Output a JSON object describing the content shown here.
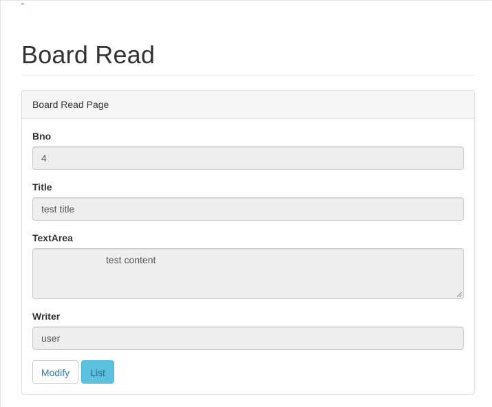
{
  "stray_mark": "\"",
  "page": {
    "title": "Board Read"
  },
  "panel": {
    "heading": "Board Read Page"
  },
  "fields": {
    "bno": {
      "label": "Bno",
      "value": "4"
    },
    "title": {
      "label": "Title",
      "value": "test title"
    },
    "textarea": {
      "label": "TextArea",
      "value": "test content"
    },
    "writer": {
      "label": "Writer",
      "value": "user"
    }
  },
  "buttons": {
    "modify": "Modify",
    "list": "List"
  },
  "colors": {
    "primary_link": "#337ab7",
    "info_button": "#5bc0de",
    "readonly_field": "#eeeeee"
  }
}
